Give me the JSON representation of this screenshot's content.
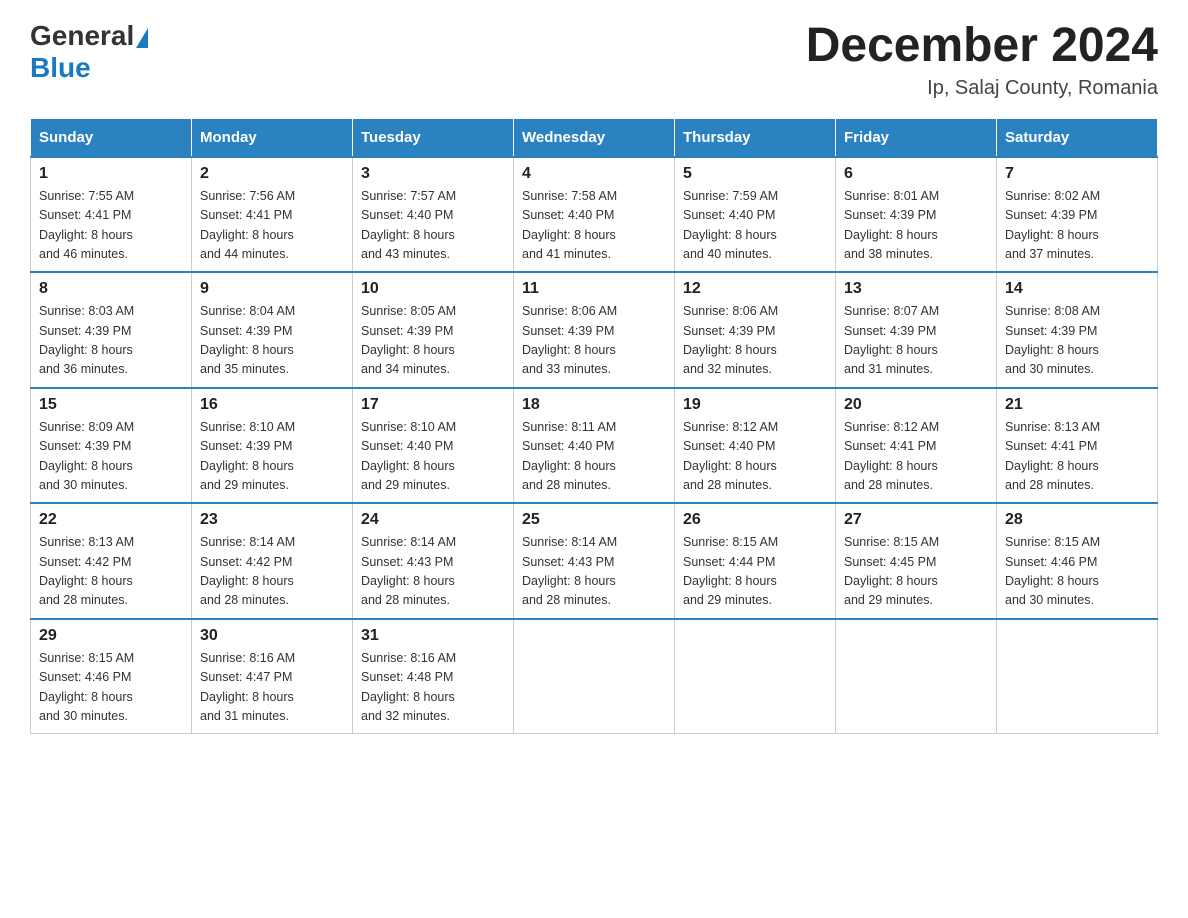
{
  "header": {
    "logo_general": "General",
    "logo_blue": "Blue",
    "month_year": "December 2024",
    "location": "Ip, Salaj County, Romania"
  },
  "weekdays": [
    "Sunday",
    "Monday",
    "Tuesday",
    "Wednesday",
    "Thursday",
    "Friday",
    "Saturday"
  ],
  "weeks": [
    [
      {
        "day": "1",
        "sunrise": "7:55 AM",
        "sunset": "4:41 PM",
        "daylight": "8 hours and 46 minutes."
      },
      {
        "day": "2",
        "sunrise": "7:56 AM",
        "sunset": "4:41 PM",
        "daylight": "8 hours and 44 minutes."
      },
      {
        "day": "3",
        "sunrise": "7:57 AM",
        "sunset": "4:40 PM",
        "daylight": "8 hours and 43 minutes."
      },
      {
        "day": "4",
        "sunrise": "7:58 AM",
        "sunset": "4:40 PM",
        "daylight": "8 hours and 41 minutes."
      },
      {
        "day": "5",
        "sunrise": "7:59 AM",
        "sunset": "4:40 PM",
        "daylight": "8 hours and 40 minutes."
      },
      {
        "day": "6",
        "sunrise": "8:01 AM",
        "sunset": "4:39 PM",
        "daylight": "8 hours and 38 minutes."
      },
      {
        "day": "7",
        "sunrise": "8:02 AM",
        "sunset": "4:39 PM",
        "daylight": "8 hours and 37 minutes."
      }
    ],
    [
      {
        "day": "8",
        "sunrise": "8:03 AM",
        "sunset": "4:39 PM",
        "daylight": "8 hours and 36 minutes."
      },
      {
        "day": "9",
        "sunrise": "8:04 AM",
        "sunset": "4:39 PM",
        "daylight": "8 hours and 35 minutes."
      },
      {
        "day": "10",
        "sunrise": "8:05 AM",
        "sunset": "4:39 PM",
        "daylight": "8 hours and 34 minutes."
      },
      {
        "day": "11",
        "sunrise": "8:06 AM",
        "sunset": "4:39 PM",
        "daylight": "8 hours and 33 minutes."
      },
      {
        "day": "12",
        "sunrise": "8:06 AM",
        "sunset": "4:39 PM",
        "daylight": "8 hours and 32 minutes."
      },
      {
        "day": "13",
        "sunrise": "8:07 AM",
        "sunset": "4:39 PM",
        "daylight": "8 hours and 31 minutes."
      },
      {
        "day": "14",
        "sunrise": "8:08 AM",
        "sunset": "4:39 PM",
        "daylight": "8 hours and 30 minutes."
      }
    ],
    [
      {
        "day": "15",
        "sunrise": "8:09 AM",
        "sunset": "4:39 PM",
        "daylight": "8 hours and 30 minutes."
      },
      {
        "day": "16",
        "sunrise": "8:10 AM",
        "sunset": "4:39 PM",
        "daylight": "8 hours and 29 minutes."
      },
      {
        "day": "17",
        "sunrise": "8:10 AM",
        "sunset": "4:40 PM",
        "daylight": "8 hours and 29 minutes."
      },
      {
        "day": "18",
        "sunrise": "8:11 AM",
        "sunset": "4:40 PM",
        "daylight": "8 hours and 28 minutes."
      },
      {
        "day": "19",
        "sunrise": "8:12 AM",
        "sunset": "4:40 PM",
        "daylight": "8 hours and 28 minutes."
      },
      {
        "day": "20",
        "sunrise": "8:12 AM",
        "sunset": "4:41 PM",
        "daylight": "8 hours and 28 minutes."
      },
      {
        "day": "21",
        "sunrise": "8:13 AM",
        "sunset": "4:41 PM",
        "daylight": "8 hours and 28 minutes."
      }
    ],
    [
      {
        "day": "22",
        "sunrise": "8:13 AM",
        "sunset": "4:42 PM",
        "daylight": "8 hours and 28 minutes."
      },
      {
        "day": "23",
        "sunrise": "8:14 AM",
        "sunset": "4:42 PM",
        "daylight": "8 hours and 28 minutes."
      },
      {
        "day": "24",
        "sunrise": "8:14 AM",
        "sunset": "4:43 PM",
        "daylight": "8 hours and 28 minutes."
      },
      {
        "day": "25",
        "sunrise": "8:14 AM",
        "sunset": "4:43 PM",
        "daylight": "8 hours and 28 minutes."
      },
      {
        "day": "26",
        "sunrise": "8:15 AM",
        "sunset": "4:44 PM",
        "daylight": "8 hours and 29 minutes."
      },
      {
        "day": "27",
        "sunrise": "8:15 AM",
        "sunset": "4:45 PM",
        "daylight": "8 hours and 29 minutes."
      },
      {
        "day": "28",
        "sunrise": "8:15 AM",
        "sunset": "4:46 PM",
        "daylight": "8 hours and 30 minutes."
      }
    ],
    [
      {
        "day": "29",
        "sunrise": "8:15 AM",
        "sunset": "4:46 PM",
        "daylight": "8 hours and 30 minutes."
      },
      {
        "day": "30",
        "sunrise": "8:16 AM",
        "sunset": "4:47 PM",
        "daylight": "8 hours and 31 minutes."
      },
      {
        "day": "31",
        "sunrise": "8:16 AM",
        "sunset": "4:48 PM",
        "daylight": "8 hours and 32 minutes."
      },
      null,
      null,
      null,
      null
    ]
  ],
  "labels": {
    "sunrise": "Sunrise:",
    "sunset": "Sunset:",
    "daylight": "Daylight:"
  }
}
